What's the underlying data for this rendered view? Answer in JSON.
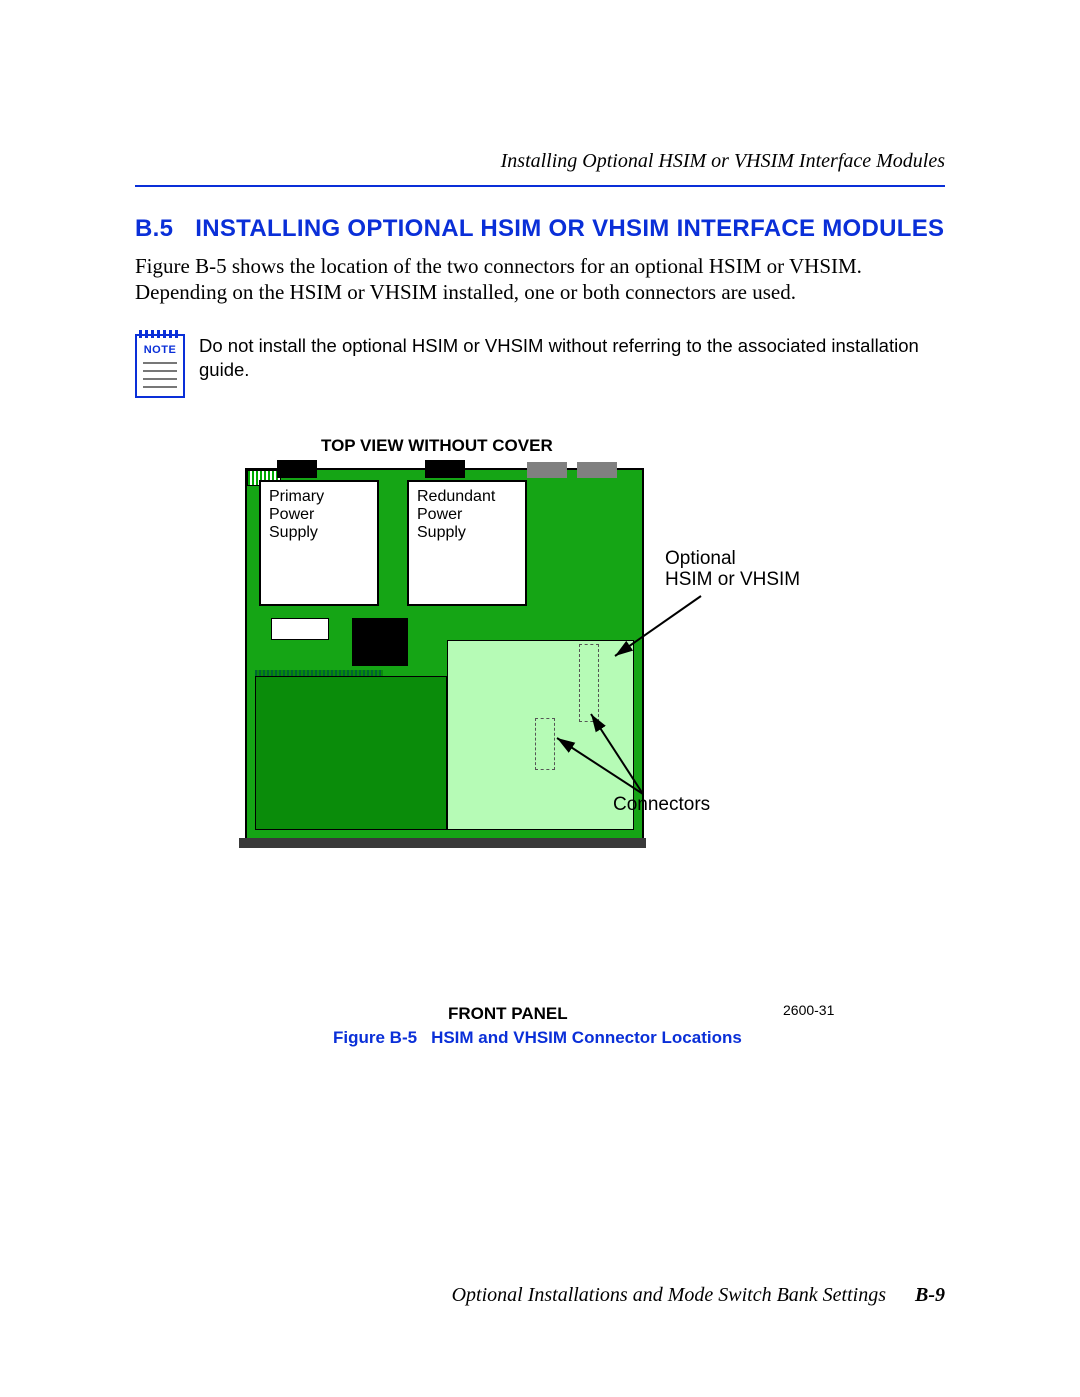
{
  "running_head": "Installing Optional HSIM or VHSIM Interface Modules",
  "section": {
    "number": "B.5",
    "title": "INSTALLING OPTIONAL HSIM OR VHSIM INTERFACE MODULES"
  },
  "body_paragraph": "Figure B-5 shows the location of the two connectors for an optional HSIM or VHSIM. Depending on the HSIM or VHSIM installed, one or both connectors are used.",
  "note": {
    "icon_label": "NOTE",
    "text": "Do not install the optional HSIM or VHSIM without referring to the associated installation guide."
  },
  "figure": {
    "top_label": "TOP VIEW WITHOUT COVER",
    "psu_primary": "Primary\nPower\nSupply",
    "psu_redundant": "Redundant\nPower\nSupply",
    "callout_optional": "Optional\nHSIM or VHSIM",
    "callout_connectors": "Connectors",
    "bottom_label": "FRONT PANEL",
    "code": "2600-31",
    "caption_lead": "Figure B-5",
    "caption_text": "HSIM and VHSIM Connector Locations"
  },
  "footer": {
    "text": "Optional Installations and Mode Switch Bank Settings",
    "page": "B-9"
  }
}
